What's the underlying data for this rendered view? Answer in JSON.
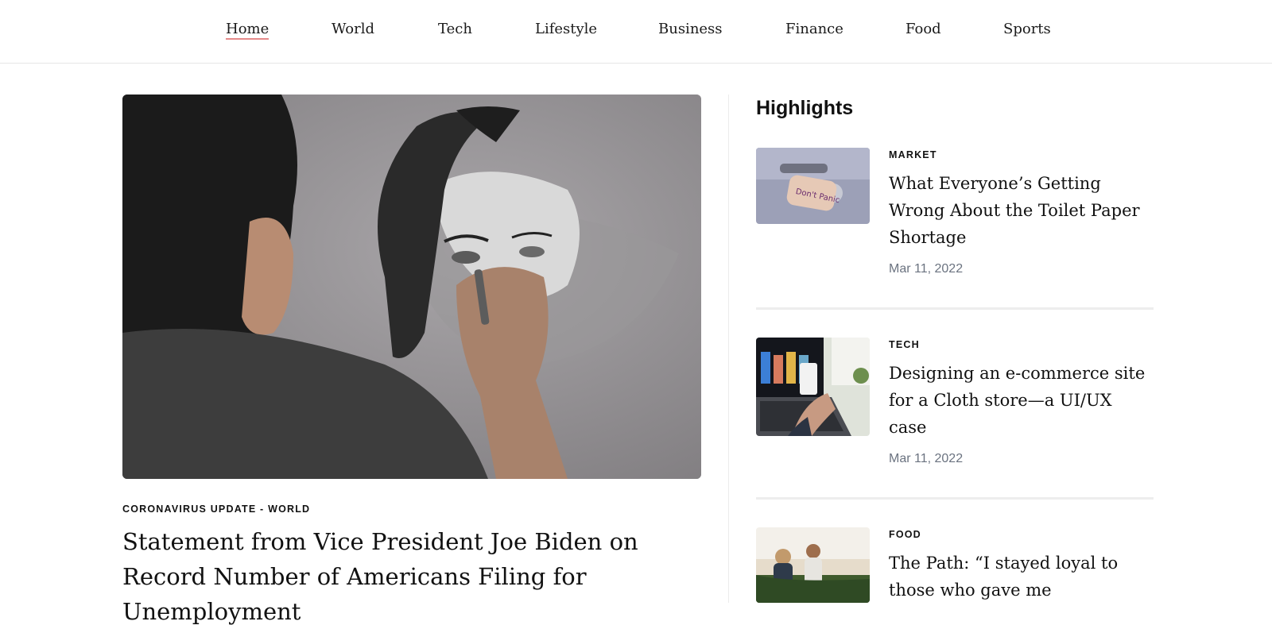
{
  "nav": {
    "items": [
      {
        "label": "Home",
        "active": true
      },
      {
        "label": "World"
      },
      {
        "label": "Tech"
      },
      {
        "label": "Lifestyle"
      },
      {
        "label": "Business"
      },
      {
        "label": "Finance"
      },
      {
        "label": "Food"
      },
      {
        "label": "Sports"
      }
    ]
  },
  "feature": {
    "image": "artist-drawing-portrait-photo",
    "category": "CORONAVIRUS UPDATE - WORLD",
    "title": "Statement from Vice President Joe Biden on Record Number of Americans Filing for Unemployment"
  },
  "highlights": {
    "heading": "Highlights",
    "items": [
      {
        "category": "MARKET",
        "title": "What Everyone’s Getting Wrong About the Toilet Paper Shortage",
        "date": "Mar 11, 2022",
        "image": "toilet-paper-roll-photo",
        "image_text": "Don't Panic"
      },
      {
        "category": "TECH",
        "title": "Designing an e-commerce site for a Cloth store—a UI/UX case",
        "date": "Mar 11, 2022",
        "image": "laptop-phone-photo"
      },
      {
        "category": "FOOD",
        "title": "The Path: “I stayed loyal to those who gave me",
        "image": "people-on-bench-beach-photo"
      }
    ]
  },
  "colors": {
    "accent_underline": "#e58a8a",
    "date_text": "#6b7380",
    "separator": "#ededed"
  }
}
